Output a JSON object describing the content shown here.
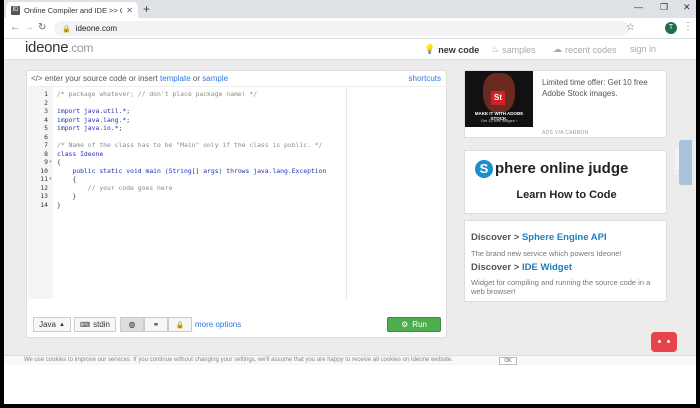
{
  "browser": {
    "tab_title": "Online Compiler and IDE >> C/C",
    "tab_favicon": "ID",
    "url": "ideone.com",
    "avatar_initial": "T"
  },
  "site": {
    "logo_main": "ideone",
    "logo_suffix": ".com",
    "nav": [
      {
        "label": "new code",
        "icon": "code-icon"
      },
      {
        "label": "samples",
        "icon": "bulb-icon"
      },
      {
        "label": "recent codes",
        "icon": "cloud-icon"
      },
      {
        "label": "sign in",
        "icon": ""
      }
    ]
  },
  "editor": {
    "prompt_prefix": "</> enter your source code or insert",
    "template_link": "template",
    "or_text": "or",
    "sample_link": "sample",
    "shortcuts": "shortcuts",
    "lines": [
      {
        "n": "1",
        "text": "/* package whatever; // don't place package name! */"
      },
      {
        "n": "2",
        "text": ""
      },
      {
        "n": "3",
        "text": "import java.util.*;"
      },
      {
        "n": "4",
        "text": "import java.lang.*;"
      },
      {
        "n": "5",
        "text": "import java.io.*;"
      },
      {
        "n": "6",
        "text": ""
      },
      {
        "n": "7",
        "text": "/* Name of the class has to be \"Main\" only if the class is public. */"
      },
      {
        "n": "8",
        "text": "class Ideone"
      },
      {
        "n": "9",
        "text": "{"
      },
      {
        "n": "10",
        "text": "    public static void main (String[] args) throws java.lang.Exception"
      },
      {
        "n": "11",
        "text": "    {"
      },
      {
        "n": "12",
        "text": "        // your code goes here"
      },
      {
        "n": "13",
        "text": "    }"
      },
      {
        "n": "14",
        "text": "}"
      }
    ],
    "language": "Java",
    "stdin": "stdin",
    "more_options": "more options",
    "run": "Run"
  },
  "ad": {
    "caption1": "MAKE IT WITH ADOBE STOCK.",
    "caption2": "Get 10 free images ›",
    "text": "Limited time offer: Get 10 free Adobe Stock images.",
    "via": "ADS VIA CARBON"
  },
  "sphere": {
    "title": "phere online judge",
    "letter": "S",
    "subtitle": "Learn How to Code"
  },
  "discover": {
    "h1_prefix": "Discover >",
    "h1_link": "Sphere Engine API",
    "p1": "The brand new service which powers Ideone!",
    "h2_prefix": "Discover >",
    "h2_link": "IDE Widget",
    "p2": "Widget for compiling and running the source code in a web browser!"
  },
  "feedback": "Feedback",
  "cookie": {
    "text": "We use cookies to improve our services. If you continue without changing your settings, we'll assume that you are happy to receive all cookies on Ideone website.",
    "ok": "OK"
  }
}
